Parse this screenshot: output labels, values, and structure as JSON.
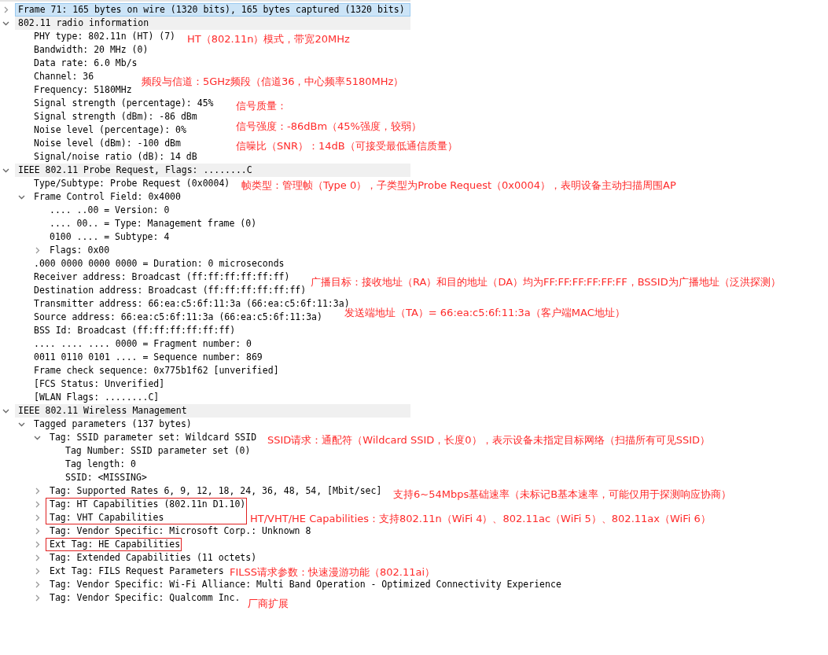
{
  "tree": [
    {
      "label": "Frame 71: 165 bytes on wire (1320 bits), 165 bytes captured (1320 bits)",
      "selected": true,
      "expanded": false
    },
    {
      "label": "802.11 radio information",
      "selected": false,
      "expanded": true,
      "children": [
        {
          "label": "PHY type: 802.11n (HT) (7)",
          "selected": false
        },
        {
          "label": "Bandwidth: 20 MHz (0)",
          "selected": false
        },
        {
          "label": "Data rate: 6.0 Mb/s",
          "selected": false
        },
        {
          "label": "Channel: 36",
          "selected": false
        },
        {
          "label": "Frequency: 5180MHz",
          "selected": false
        },
        {
          "label": "Signal strength (percentage): 45%",
          "selected": false
        },
        {
          "label": "Signal strength (dBm): -86 dBm",
          "selected": false
        },
        {
          "label": "Noise level (percentage): 0%",
          "selected": false
        },
        {
          "label": "Noise level (dBm): -100 dBm",
          "selected": false
        },
        {
          "label": "Signal/noise ratio (dB): 14 dB",
          "selected": false
        }
      ]
    },
    {
      "label": "IEEE 802.11 Probe Request, Flags: ........C",
      "selected": false,
      "expanded": true,
      "children": [
        {
          "label": "Type/Subtype: Probe Request (0x0004)",
          "selected": false
        },
        {
          "label": "Frame Control Field: 0x4000",
          "selected": false,
          "expanded": true,
          "children": [
            {
              "label": ".... ..00 = Version: 0",
              "selected": false
            },
            {
              "label": ".... 00.. = Type: Management frame (0)",
              "selected": false
            },
            {
              "label": "0100 .... = Subtype: 4",
              "selected": false
            },
            {
              "label": "Flags: 0x00",
              "selected": false,
              "expanded": false
            }
          ]
        },
        {
          "label": ".000 0000 0000 0000 = Duration: 0 microseconds",
          "selected": false
        },
        {
          "label": "Receiver address: Broadcast (ff:ff:ff:ff:ff:ff)",
          "selected": false
        },
        {
          "label": "Destination address: Broadcast (ff:ff:ff:ff:ff:ff)",
          "selected": false
        },
        {
          "label": "Transmitter address: 66:ea:c5:6f:11:3a (66:ea:c5:6f:11:3a)",
          "selected": false
        },
        {
          "label": "Source address: 66:ea:c5:6f:11:3a (66:ea:c5:6f:11:3a)",
          "selected": false
        },
        {
          "label": "BSS Id: Broadcast (ff:ff:ff:ff:ff:ff)",
          "selected": false
        },
        {
          "label": ".... .... .... 0000 = Fragment number: 0",
          "selected": false
        },
        {
          "label": "0011 0110 0101 .... = Sequence number: 869",
          "selected": false
        },
        {
          "label": "Frame check sequence: 0x775b1f62 [unverified]",
          "selected": false
        },
        {
          "label": "[FCS Status: Unverified]",
          "selected": false
        },
        {
          "label": "[WLAN Flags: ........C]",
          "selected": false
        }
      ]
    },
    {
      "label": "IEEE 802.11 Wireless Management",
      "selected": false,
      "expanded": true,
      "children": [
        {
          "label": "Tagged parameters (137 bytes)",
          "selected": false,
          "expanded": true,
          "children": [
            {
              "label": "Tag: SSID parameter set: Wildcard SSID",
              "selected": false,
              "expanded": true,
              "children": [
                {
                  "label": "Tag Number: SSID parameter set (0)",
                  "selected": false
                },
                {
                  "label": "Tag length: 0",
                  "selected": false
                },
                {
                  "label": "SSID: <MISSING>",
                  "selected": false
                }
              ]
            },
            {
              "label": "Tag: Supported Rates 6, 9, 12, 18, 24, 36, 48, 54, [Mbit/sec]",
              "selected": false,
              "expanded": false,
              "outlined": false
            },
            {
              "label": "Tag: HT Capabilities (802.11n D1.10)",
              "selected": false,
              "expanded": false,
              "outlined": true
            },
            {
              "label": "Tag: VHT Capabilities",
              "selected": false,
              "expanded": false,
              "outlined": true
            },
            {
              "label": "Tag: Vendor Specific: Microsoft Corp.: Unknown 8",
              "selected": false,
              "expanded": false,
              "outlined": false
            },
            {
              "label": "Ext Tag: HE Capabilities",
              "selected": false,
              "expanded": false,
              "outlined": true
            },
            {
              "label": "Tag: Extended Capabilities (11 octets)",
              "selected": false,
              "expanded": false,
              "outlined": false
            },
            {
              "label": "Ext Tag: FILS Request Parameters",
              "selected": false,
              "expanded": false,
              "outlined": false
            },
            {
              "label": "Tag: Vendor Specific: Wi-Fi Alliance: Multi Band Operation - Optimized Connectivity Experience",
              "selected": false,
              "expanded": false,
              "outlined": false
            },
            {
              "label": "Tag: Vendor Specific: Qualcomm Inc.",
              "selected": false,
              "expanded": false,
              "outlined": false
            }
          ]
        }
      ]
    }
  ],
  "annotations": [
    "HT（802.11n）模式，带宽20MHz",
    "频段与信道：5GHz频段（信道36，中心频率5180MHz）",
    "信号质量：",
    "信号强度：-86dBm（45%强度，较弱）",
    "信噪比（SNR）：14dB（可接受最低通信质量）",
    "帧类型：管理帧（Type 0），子类型为Probe Request（0x0004），表明设备主动扫描周围AP",
    "广播目标：接收地址（RA）和目的地址（DA）均为FF:FF:FF:FF:FF:FF，BSSID为广播地址（泛洪探测）",
    "发送端地址（TA）= 66:ea:c5:6f:11:3a（客户端MAC地址）",
    "SSID请求：通配符（Wildcard SSID，长度0），表示设备未指定目标网络（扫描所有可见SSID）",
    "支持6~54Mbps基础速率（未标记B基本速率，可能仅用于探测响应协商）",
    "HT/VHT/HE Capabilities：支持802.11n（WiFi 4）、802.11ac（WiFi 5）、802.11ax（WiFi 6）",
    "FILSS请求参数：快速漫游功能（802.11ai）",
    "厂商扩展"
  ]
}
